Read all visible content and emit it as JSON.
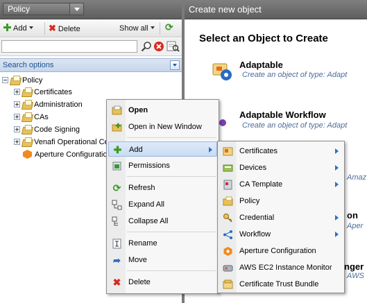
{
  "left_panel": {
    "policy_select": "Policy",
    "toolbar": {
      "add_label": "Add",
      "delete_label": "Delete",
      "show_all_label": "Show all"
    },
    "search": {
      "value": ""
    },
    "search_options_label": "Search options",
    "tree": {
      "root": "Policy",
      "items": [
        {
          "label": "Certificates",
          "expandable": true
        },
        {
          "label": "Administration",
          "expandable": true
        },
        {
          "label": "CAs",
          "expandable": true
        },
        {
          "label": "Code Signing",
          "expandable": true
        },
        {
          "label": "Venafi Operational Ce",
          "expandable": true
        },
        {
          "label": "Aperture Configuratio",
          "expandable": false
        }
      ]
    }
  },
  "right_panel": {
    "header": "Create new object",
    "title": "Select an Object to Create",
    "objects": [
      {
        "name": "Adaptable",
        "subtitle": "Create an object of type: Adapt"
      },
      {
        "name": "Adaptable Workflow",
        "subtitle": "Create an object of type: Adapt"
      }
    ],
    "partial_texts": {
      "amaz": "Amaz",
      "on": "on",
      "aper": "Aper",
      "nger": "nger",
      "aws": "AWS"
    }
  },
  "context_menu": {
    "items": [
      {
        "label": "Open",
        "icon": "open-icon",
        "bold": true
      },
      {
        "label": "Open in New Window",
        "icon": "new-window-icon"
      },
      {
        "label": "Add",
        "icon": "add-icon",
        "submenu": true
      },
      {
        "label": "Permissions",
        "icon": "permissions-icon"
      },
      {
        "label": "Refresh",
        "icon": "refresh-icon"
      },
      {
        "label": "Expand All",
        "icon": "expand-all-icon"
      },
      {
        "label": "Collapse All",
        "icon": "collapse-all-icon"
      },
      {
        "label": "Rename",
        "icon": "rename-icon"
      },
      {
        "label": "Move",
        "icon": "move-icon"
      },
      {
        "label": "Delete",
        "icon": "delete-icon"
      }
    ]
  },
  "add_submenu": {
    "items": [
      {
        "label": "Certificates",
        "icon": "certificates-icon",
        "submenu": true
      },
      {
        "label": "Devices",
        "icon": "devices-icon",
        "submenu": true
      },
      {
        "label": "CA Template",
        "icon": "ca-template-icon",
        "submenu": true
      },
      {
        "label": "Policy",
        "icon": "policy-folder-icon",
        "submenu": false
      },
      {
        "label": "Credential",
        "icon": "credential-icon",
        "submenu": true
      },
      {
        "label": "Workflow",
        "icon": "workflow-icon",
        "submenu": true
      },
      {
        "label": "Aperture Configuration",
        "icon": "aperture-icon",
        "submenu": false
      },
      {
        "label": "AWS EC2 Instance Monitor",
        "icon": "aws-monitor-icon",
        "submenu": false
      },
      {
        "label": "Certificate Trust Bundle",
        "icon": "trust-bundle-icon",
        "submenu": false
      }
    ]
  },
  "colors": {
    "header_gray": "#6e6e6e",
    "accent_blue": "#2f6fc0",
    "add_green": "#3a9a26",
    "delete_red": "#d62b1e",
    "aperture_orange": "#f08a1c"
  }
}
